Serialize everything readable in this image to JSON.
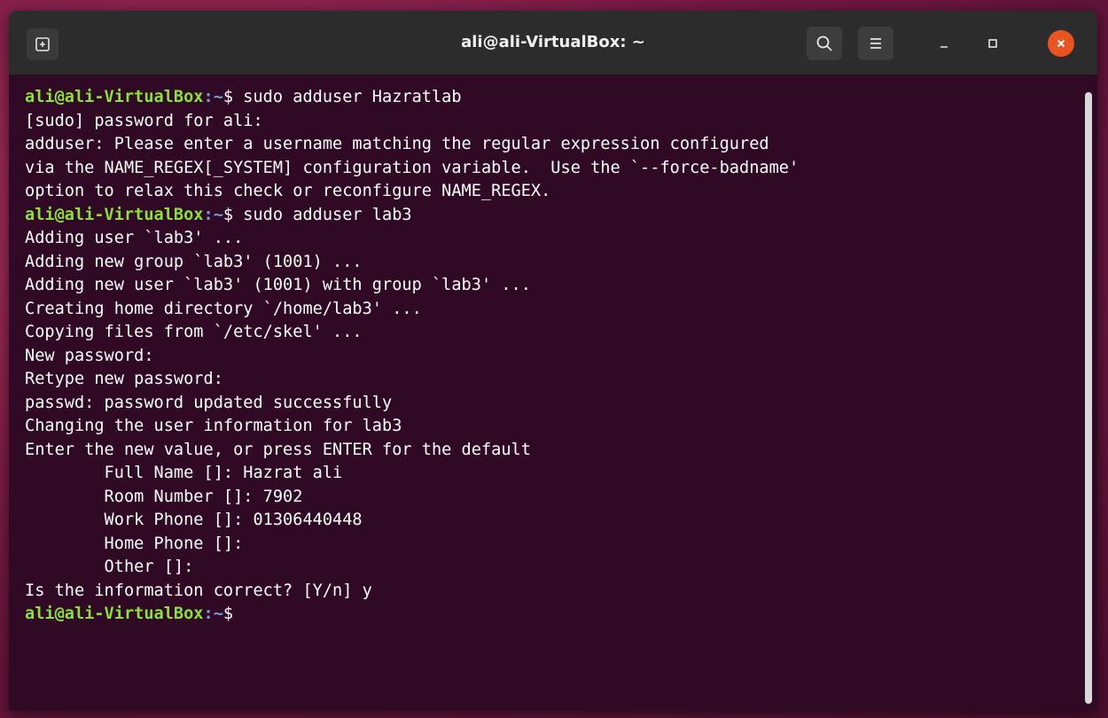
{
  "window": {
    "title": "ali@ali-VirtualBox: ~"
  },
  "icons": {
    "new_tab": "new-tab-icon",
    "search": "search-icon",
    "menu": "hamburger-menu-icon",
    "minimize": "minimize-icon",
    "maximize": "maximize-icon",
    "close": "close-icon"
  },
  "colors": {
    "terminal_bg": "#300a24",
    "prompt_user": "#8ae234",
    "prompt_path": "#729fcf",
    "close_button": "#e95420",
    "titlebar": "#2c2c2c"
  },
  "prompt": {
    "user_host": "ali@ali-VirtualBox",
    "path": ":~",
    "sign": "$ "
  },
  "lines": [
    {
      "type": "cmd",
      "text": "sudo adduser Hazratlab"
    },
    {
      "type": "out",
      "text": "[sudo] password for ali:"
    },
    {
      "type": "out",
      "text": "adduser: Please enter a username matching the regular expression configured"
    },
    {
      "type": "out",
      "text": "via the NAME_REGEX[_SYSTEM] configuration variable.  Use the `--force-badname'"
    },
    {
      "type": "out",
      "text": "option to relax this check or reconfigure NAME_REGEX."
    },
    {
      "type": "cmd",
      "text": "sudo adduser lab3"
    },
    {
      "type": "out",
      "text": "Adding user `lab3' ..."
    },
    {
      "type": "out",
      "text": "Adding new group `lab3' (1001) ..."
    },
    {
      "type": "out",
      "text": "Adding new user `lab3' (1001) with group `lab3' ..."
    },
    {
      "type": "out",
      "text": "Creating home directory `/home/lab3' ..."
    },
    {
      "type": "out",
      "text": "Copying files from `/etc/skel' ..."
    },
    {
      "type": "out",
      "text": "New password:"
    },
    {
      "type": "out",
      "text": "Retype new password:"
    },
    {
      "type": "out",
      "text": "passwd: password updated successfully"
    },
    {
      "type": "out",
      "text": "Changing the user information for lab3"
    },
    {
      "type": "out",
      "text": "Enter the new value, or press ENTER for the default"
    },
    {
      "type": "out",
      "text": "\tFull Name []: Hazrat ali"
    },
    {
      "type": "out",
      "text": "\tRoom Number []: 7902"
    },
    {
      "type": "out",
      "text": "\tWork Phone []: 01306440448"
    },
    {
      "type": "out",
      "text": "\tHome Phone []:"
    },
    {
      "type": "out",
      "text": "\tOther []:"
    },
    {
      "type": "out",
      "text": "Is the information correct? [Y/n] y"
    },
    {
      "type": "cmd",
      "text": ""
    }
  ]
}
